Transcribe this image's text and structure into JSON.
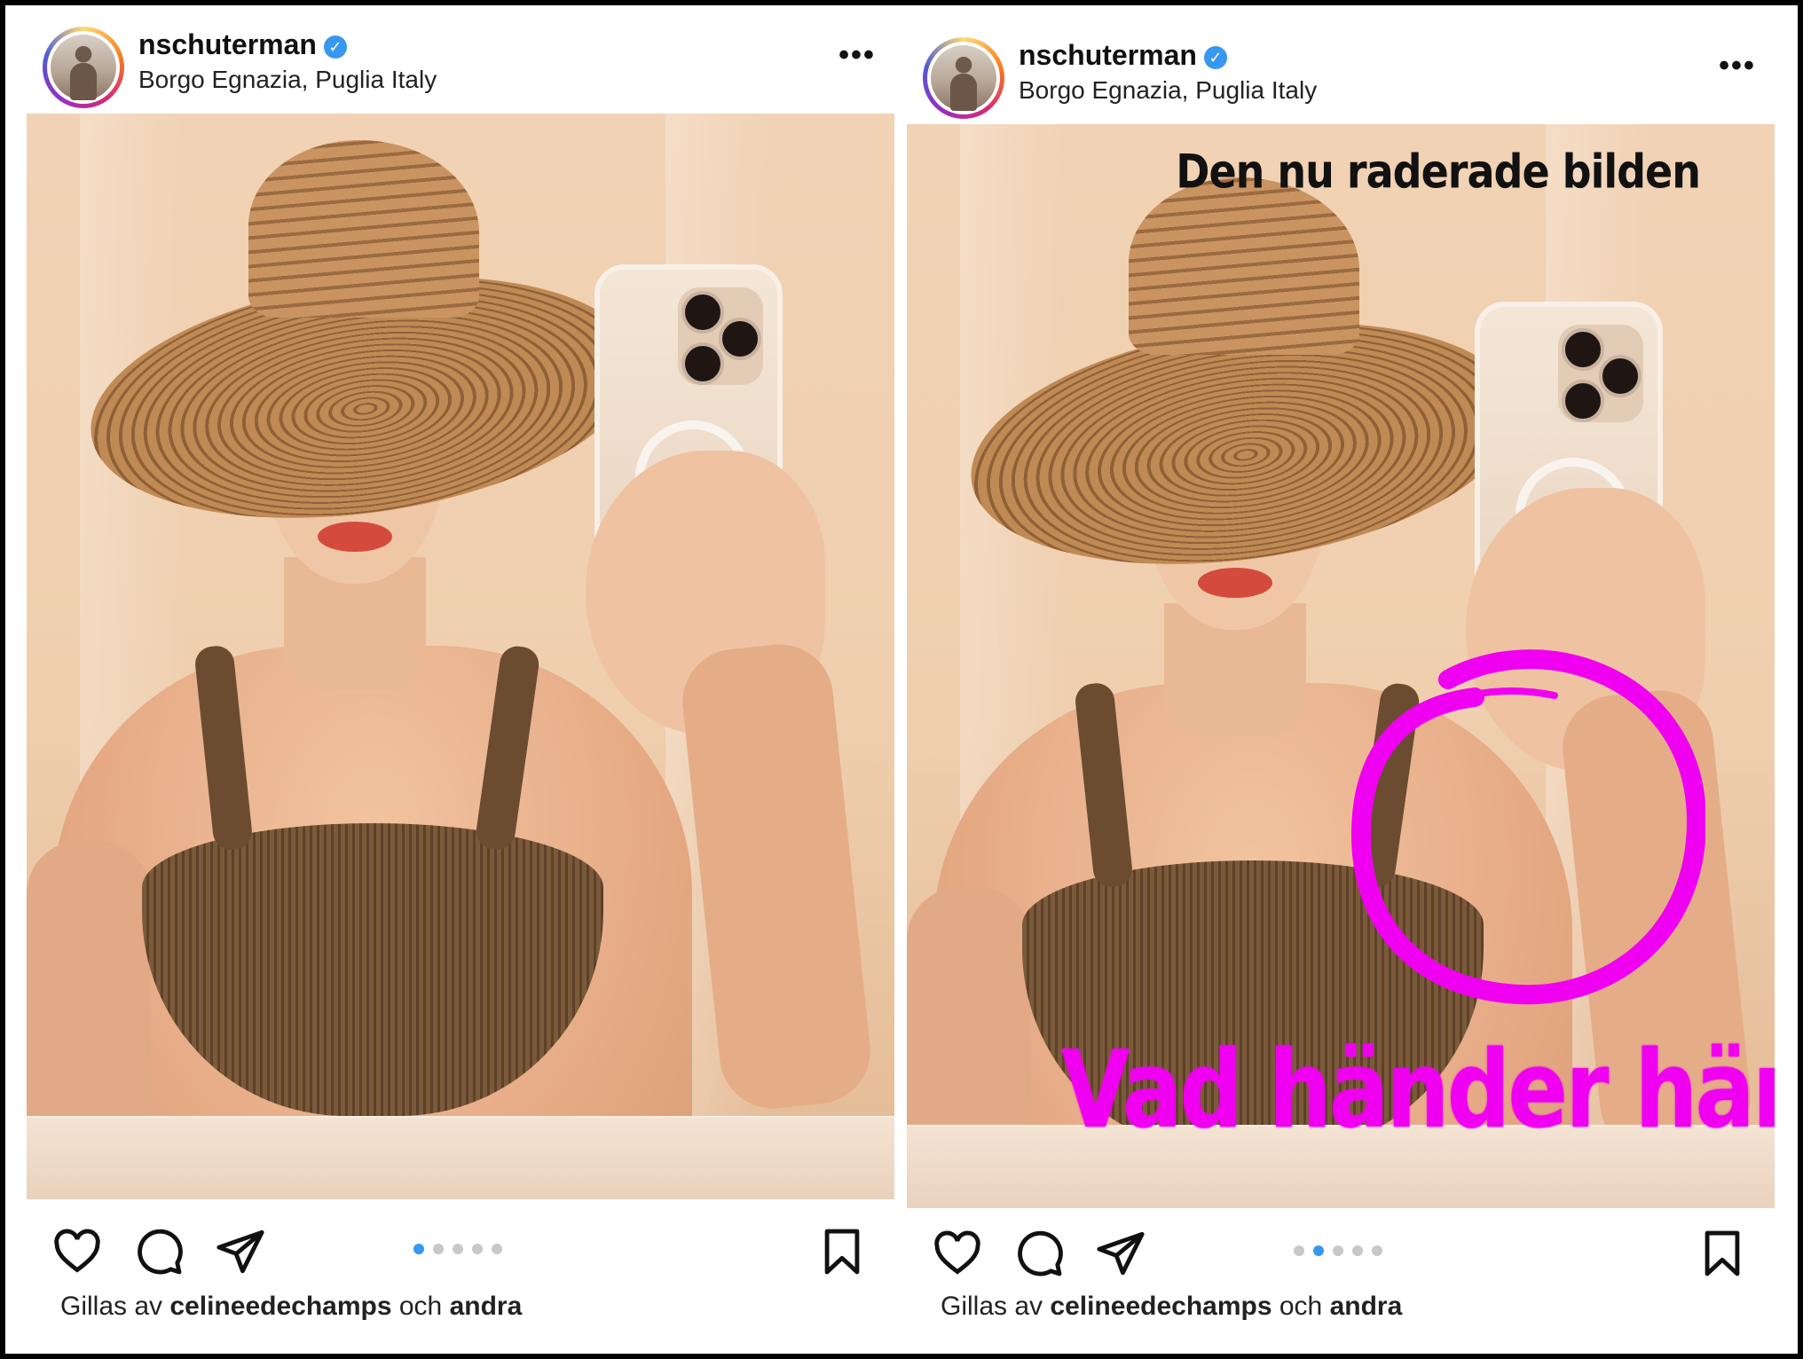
{
  "colors": {
    "annotation_magenta": "#f000f0",
    "active_dot": "#3897f0",
    "verified_badge": "#3897f0"
  },
  "posts": [
    {
      "username": "nschuterman",
      "location": "Borgo Egnazia, Puglia Italy",
      "more_icon": "more-horizontal-icon",
      "carousel": {
        "total": 5,
        "active_index": 1
      },
      "likes_prefix": "Gillas av",
      "likes_user": "celineedechamps",
      "likes_mid": "och",
      "likes_suffix": "andra"
    },
    {
      "username": "nschuterman",
      "location": "Borgo Egnazia, Puglia Italy",
      "more_icon": "more-horizontal-icon",
      "carousel": {
        "total": 5,
        "active_index": 2
      },
      "overlay_title": "Den nu raderade bilden",
      "overlay_question": "Vad händer här?",
      "likes_prefix": "Gillas av",
      "likes_user": "celineedechamps",
      "likes_mid": "och",
      "likes_suffix": "andra"
    }
  ],
  "icons": {
    "like": "heart-icon",
    "comment": "comment-icon",
    "share": "send-icon",
    "save": "bookmark-icon",
    "verified": "verified-badge-icon"
  },
  "verified_glyph": "✓",
  "more_glyph": "•••"
}
